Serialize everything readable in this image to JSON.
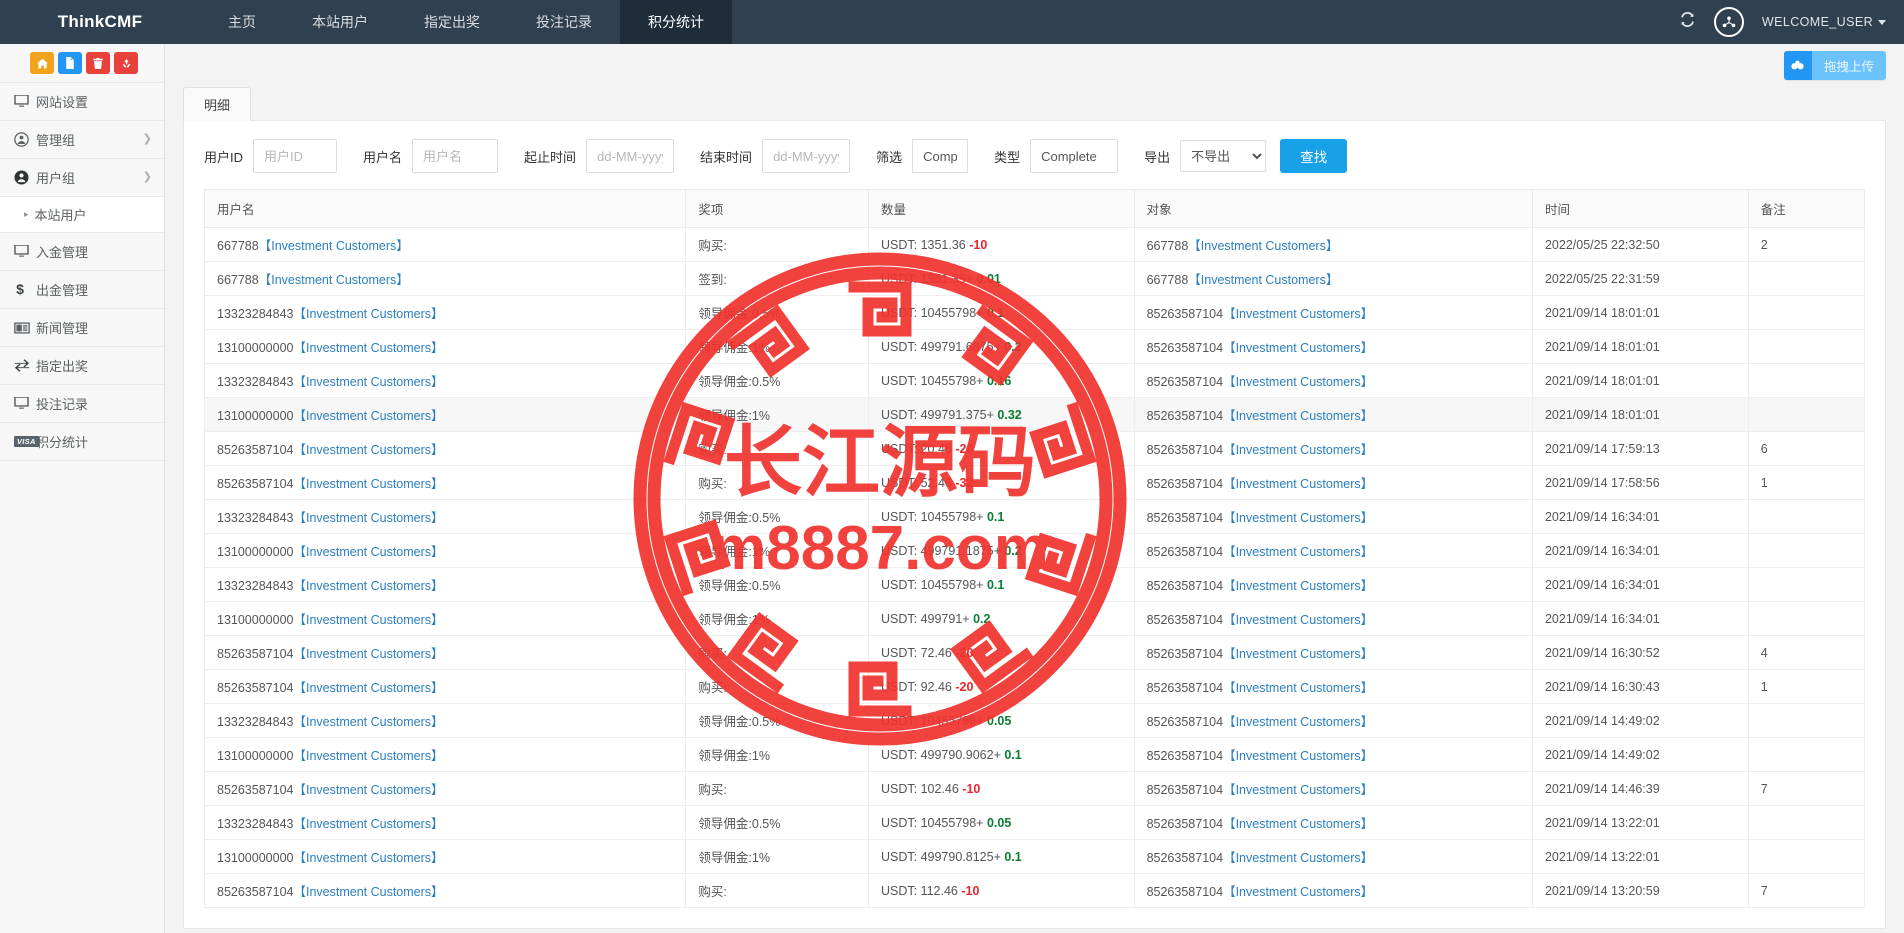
{
  "topnav": {
    "brand": "ThinkCMF",
    "links": [
      {
        "label": "主页",
        "active": false
      },
      {
        "label": "本站用户",
        "active": false
      },
      {
        "label": "指定出奖",
        "active": false
      },
      {
        "label": "投注记录",
        "active": false
      },
      {
        "label": "积分统计",
        "active": true
      }
    ],
    "refresh_icon": "refresh-icon",
    "avatar_icon": "user-network-icon",
    "welcome": "WELCOME_USER",
    "accent": "#2f4050"
  },
  "sidebar": {
    "tools": [
      {
        "name": "home-icon",
        "color": "#f0a31b",
        "glyph": "⌂"
      },
      {
        "name": "file-icon",
        "color": "#2196f3",
        "glyph": "὜E"
      },
      {
        "name": "trash-icon",
        "color": "#e8403a",
        "glyph": "Ὕ1"
      },
      {
        "name": "recycle-icon",
        "color": "#e8403a",
        "glyph": "♻"
      }
    ],
    "items": [
      {
        "label": "网站设置",
        "icon": "monitor-icon",
        "arrow": false,
        "sub": false
      },
      {
        "label": "管理组",
        "icon": "user-circle-icon",
        "arrow": true,
        "sub": false
      },
      {
        "label": "用户组",
        "icon": "user-filled-icon",
        "arrow": true,
        "sub": false
      },
      {
        "label": "本站用户",
        "icon": "caret-right-icon",
        "arrow": false,
        "sub": true
      },
      {
        "label": "入金管理",
        "icon": "monitor-icon",
        "arrow": false,
        "sub": false
      },
      {
        "label": "出金管理",
        "icon": "dollar-icon",
        "arrow": false,
        "sub": false
      },
      {
        "label": "新闻管理",
        "icon": "news-icon",
        "arrow": false,
        "sub": false
      },
      {
        "label": "指定出奖",
        "icon": "exchange-icon",
        "arrow": false,
        "sub": false
      },
      {
        "label": "投注记录",
        "icon": "monitor-icon",
        "arrow": false,
        "sub": false
      },
      {
        "label": "积分统计",
        "icon": "visa-icon",
        "arrow": false,
        "sub": false
      }
    ]
  },
  "upload": {
    "icon": "cloud-upload-icon",
    "label": "拖拽上传"
  },
  "tabs": [
    {
      "label": "明细",
      "active": true
    }
  ],
  "filters": {
    "userid_label": "用户ID",
    "userid_value": "",
    "userid_placeholder": "用户ID",
    "username_label": "用户名",
    "username_value": "",
    "username_placeholder": "用户名",
    "start_label": "起止时间",
    "start_value": "",
    "start_placeholder": "dd-MM-yyyy",
    "end_label": "结束时间",
    "end_value": "",
    "end_placeholder": "dd-MM-yyyy",
    "filter_label": "筛选",
    "filter_value": "Comple",
    "type_label": "类型",
    "type_value": "Complete",
    "export_label": "导出",
    "export_selected": "不导出",
    "export_options": [
      "不导出"
    ],
    "search_button": "查找",
    "search_button_color": "#18a0e8"
  },
  "table": {
    "headers": [
      "用户名",
      "奖项",
      "数量",
      "对象",
      "时间",
      "备注"
    ],
    "rows": [
      {
        "user": "667788【Investment Customers】",
        "prize": "购买:",
        "amount_base": "USDT: 1351.36",
        "delta": "-10",
        "delta_sign": "neg",
        "object": "667788【Investment Customers】",
        "time": "2022/05/25 22:32:50",
        "note": "2"
      },
      {
        "user": "667788【Investment Customers】",
        "prize": "签到:",
        "amount_base": "USDT: 1351.35+",
        "delta": "0.01",
        "delta_sign": "pos",
        "object": "667788【Investment Customers】",
        "time": "2022/05/25 22:31:59",
        "note": ""
      },
      {
        "user": "13323284843【Investment Customers】",
        "prize": "领导佣金:0.5%",
        "amount_base": "USDT: 10455798+",
        "delta": "0.1",
        "delta_sign": "pos",
        "object": "85263587104【Investment Customers】",
        "time": "2021/09/14 18:01:01",
        "note": ""
      },
      {
        "user": "13100000000【Investment Customers】",
        "prize": "领导佣金:1%",
        "amount_base": "USDT: 499791.6875+",
        "delta": "0.2",
        "delta_sign": "pos",
        "object": "85263587104【Investment Customers】",
        "time": "2021/09/14 18:01:01",
        "note": ""
      },
      {
        "user": "13323284843【Investment Customers】",
        "prize": "领导佣金:0.5%",
        "amount_base": "USDT: 10455798+",
        "delta": "0.16",
        "delta_sign": "pos",
        "object": "85263587104【Investment Customers】",
        "time": "2021/09/14 18:01:01",
        "note": ""
      },
      {
        "user": "13100000000【Investment Customers】",
        "prize": "领导佣金:1%",
        "amount_base": "USDT: 499791.375+",
        "delta": "0.32",
        "delta_sign": "pos",
        "object": "85263587104【Investment Customers】",
        "time": "2021/09/14 18:01:01",
        "note": ""
      },
      {
        "user": "85263587104【Investment Customers】",
        "prize": "购买:",
        "amount_base": "USDT: 20.46",
        "delta": "-20",
        "delta_sign": "neg",
        "object": "85263587104【Investment Customers】",
        "time": "2021/09/14 17:59:13",
        "note": "6"
      },
      {
        "user": "85263587104【Investment Customers】",
        "prize": "购买:",
        "amount_base": "USDT: 52.46",
        "delta": "-32",
        "delta_sign": "neg",
        "object": "85263587104【Investment Customers】",
        "time": "2021/09/14 17:58:56",
        "note": "1"
      },
      {
        "user": "13323284843【Investment Customers】",
        "prize": "领导佣金:0.5%",
        "amount_base": "USDT: 10455798+",
        "delta": "0.1",
        "delta_sign": "pos",
        "object": "85263587104【Investment Customers】",
        "time": "2021/09/14 16:34:01",
        "note": ""
      },
      {
        "user": "13100000000【Investment Customers】",
        "prize": "领导佣金:1%",
        "amount_base": "USDT: 499791.1875+",
        "delta": "0.2",
        "delta_sign": "pos",
        "object": "85263587104【Investment Customers】",
        "time": "2021/09/14 16:34:01",
        "note": ""
      },
      {
        "user": "13323284843【Investment Customers】",
        "prize": "领导佣金:0.5%",
        "amount_base": "USDT: 10455798+",
        "delta": "0.1",
        "delta_sign": "pos",
        "object": "85263587104【Investment Customers】",
        "time": "2021/09/14 16:34:01",
        "note": ""
      },
      {
        "user": "13100000000【Investment Customers】",
        "prize": "领导佣金:1%",
        "amount_base": "USDT: 499791+",
        "delta": "0.2",
        "delta_sign": "pos",
        "object": "85263587104【Investment Customers】",
        "time": "2021/09/14 16:34:01",
        "note": ""
      },
      {
        "user": "85263587104【Investment Customers】",
        "prize": "购买:",
        "amount_base": "USDT: 72.46",
        "delta": "-20",
        "delta_sign": "neg",
        "object": "85263587104【Investment Customers】",
        "time": "2021/09/14 16:30:52",
        "note": "4"
      },
      {
        "user": "85263587104【Investment Customers】",
        "prize": "购买:",
        "amount_base": "USDT: 92.46",
        "delta": "-20",
        "delta_sign": "neg",
        "object": "85263587104【Investment Customers】",
        "time": "2021/09/14 16:30:43",
        "note": "1"
      },
      {
        "user": "13323284843【Investment Customers】",
        "prize": "领导佣金:0.5%",
        "amount_base": "USDT: 10455798+",
        "delta": "0.05",
        "delta_sign": "pos",
        "object": "85263587104【Investment Customers】",
        "time": "2021/09/14 14:49:02",
        "note": ""
      },
      {
        "user": "13100000000【Investment Customers】",
        "prize": "领导佣金:1%",
        "amount_base": "USDT: 499790.9062+",
        "delta": "0.1",
        "delta_sign": "pos",
        "object": "85263587104【Investment Customers】",
        "time": "2021/09/14 14:49:02",
        "note": ""
      },
      {
        "user": "85263587104【Investment Customers】",
        "prize": "购买:",
        "amount_base": "USDT: 102.46",
        "delta": "-10",
        "delta_sign": "neg",
        "object": "85263587104【Investment Customers】",
        "time": "2021/09/14 14:46:39",
        "note": "7"
      },
      {
        "user": "13323284843【Investment Customers】",
        "prize": "领导佣金:0.5%",
        "amount_base": "USDT: 10455798+",
        "delta": "0.05",
        "delta_sign": "pos",
        "object": "85263587104【Investment Customers】",
        "time": "2021/09/14 13:22:01",
        "note": ""
      },
      {
        "user": "13100000000【Investment Customers】",
        "prize": "领导佣金:1%",
        "amount_base": "USDT: 499790.8125+",
        "delta": "0.1",
        "delta_sign": "pos",
        "object": "85263587104【Investment Customers】",
        "time": "2021/09/14 13:22:01",
        "note": ""
      },
      {
        "user": "85263587104【Investment Customers】",
        "prize": "购买:",
        "amount_base": "USDT: 112.46",
        "delta": "-10",
        "delta_sign": "neg",
        "object": "85263587104【Investment Customers】",
        "time": "2021/09/14 13:20:59",
        "note": "7"
      }
    ]
  },
  "watermark": {
    "text_cn": "长江源码",
    "text_url": "m8887.com",
    "color": "#f0322e"
  }
}
